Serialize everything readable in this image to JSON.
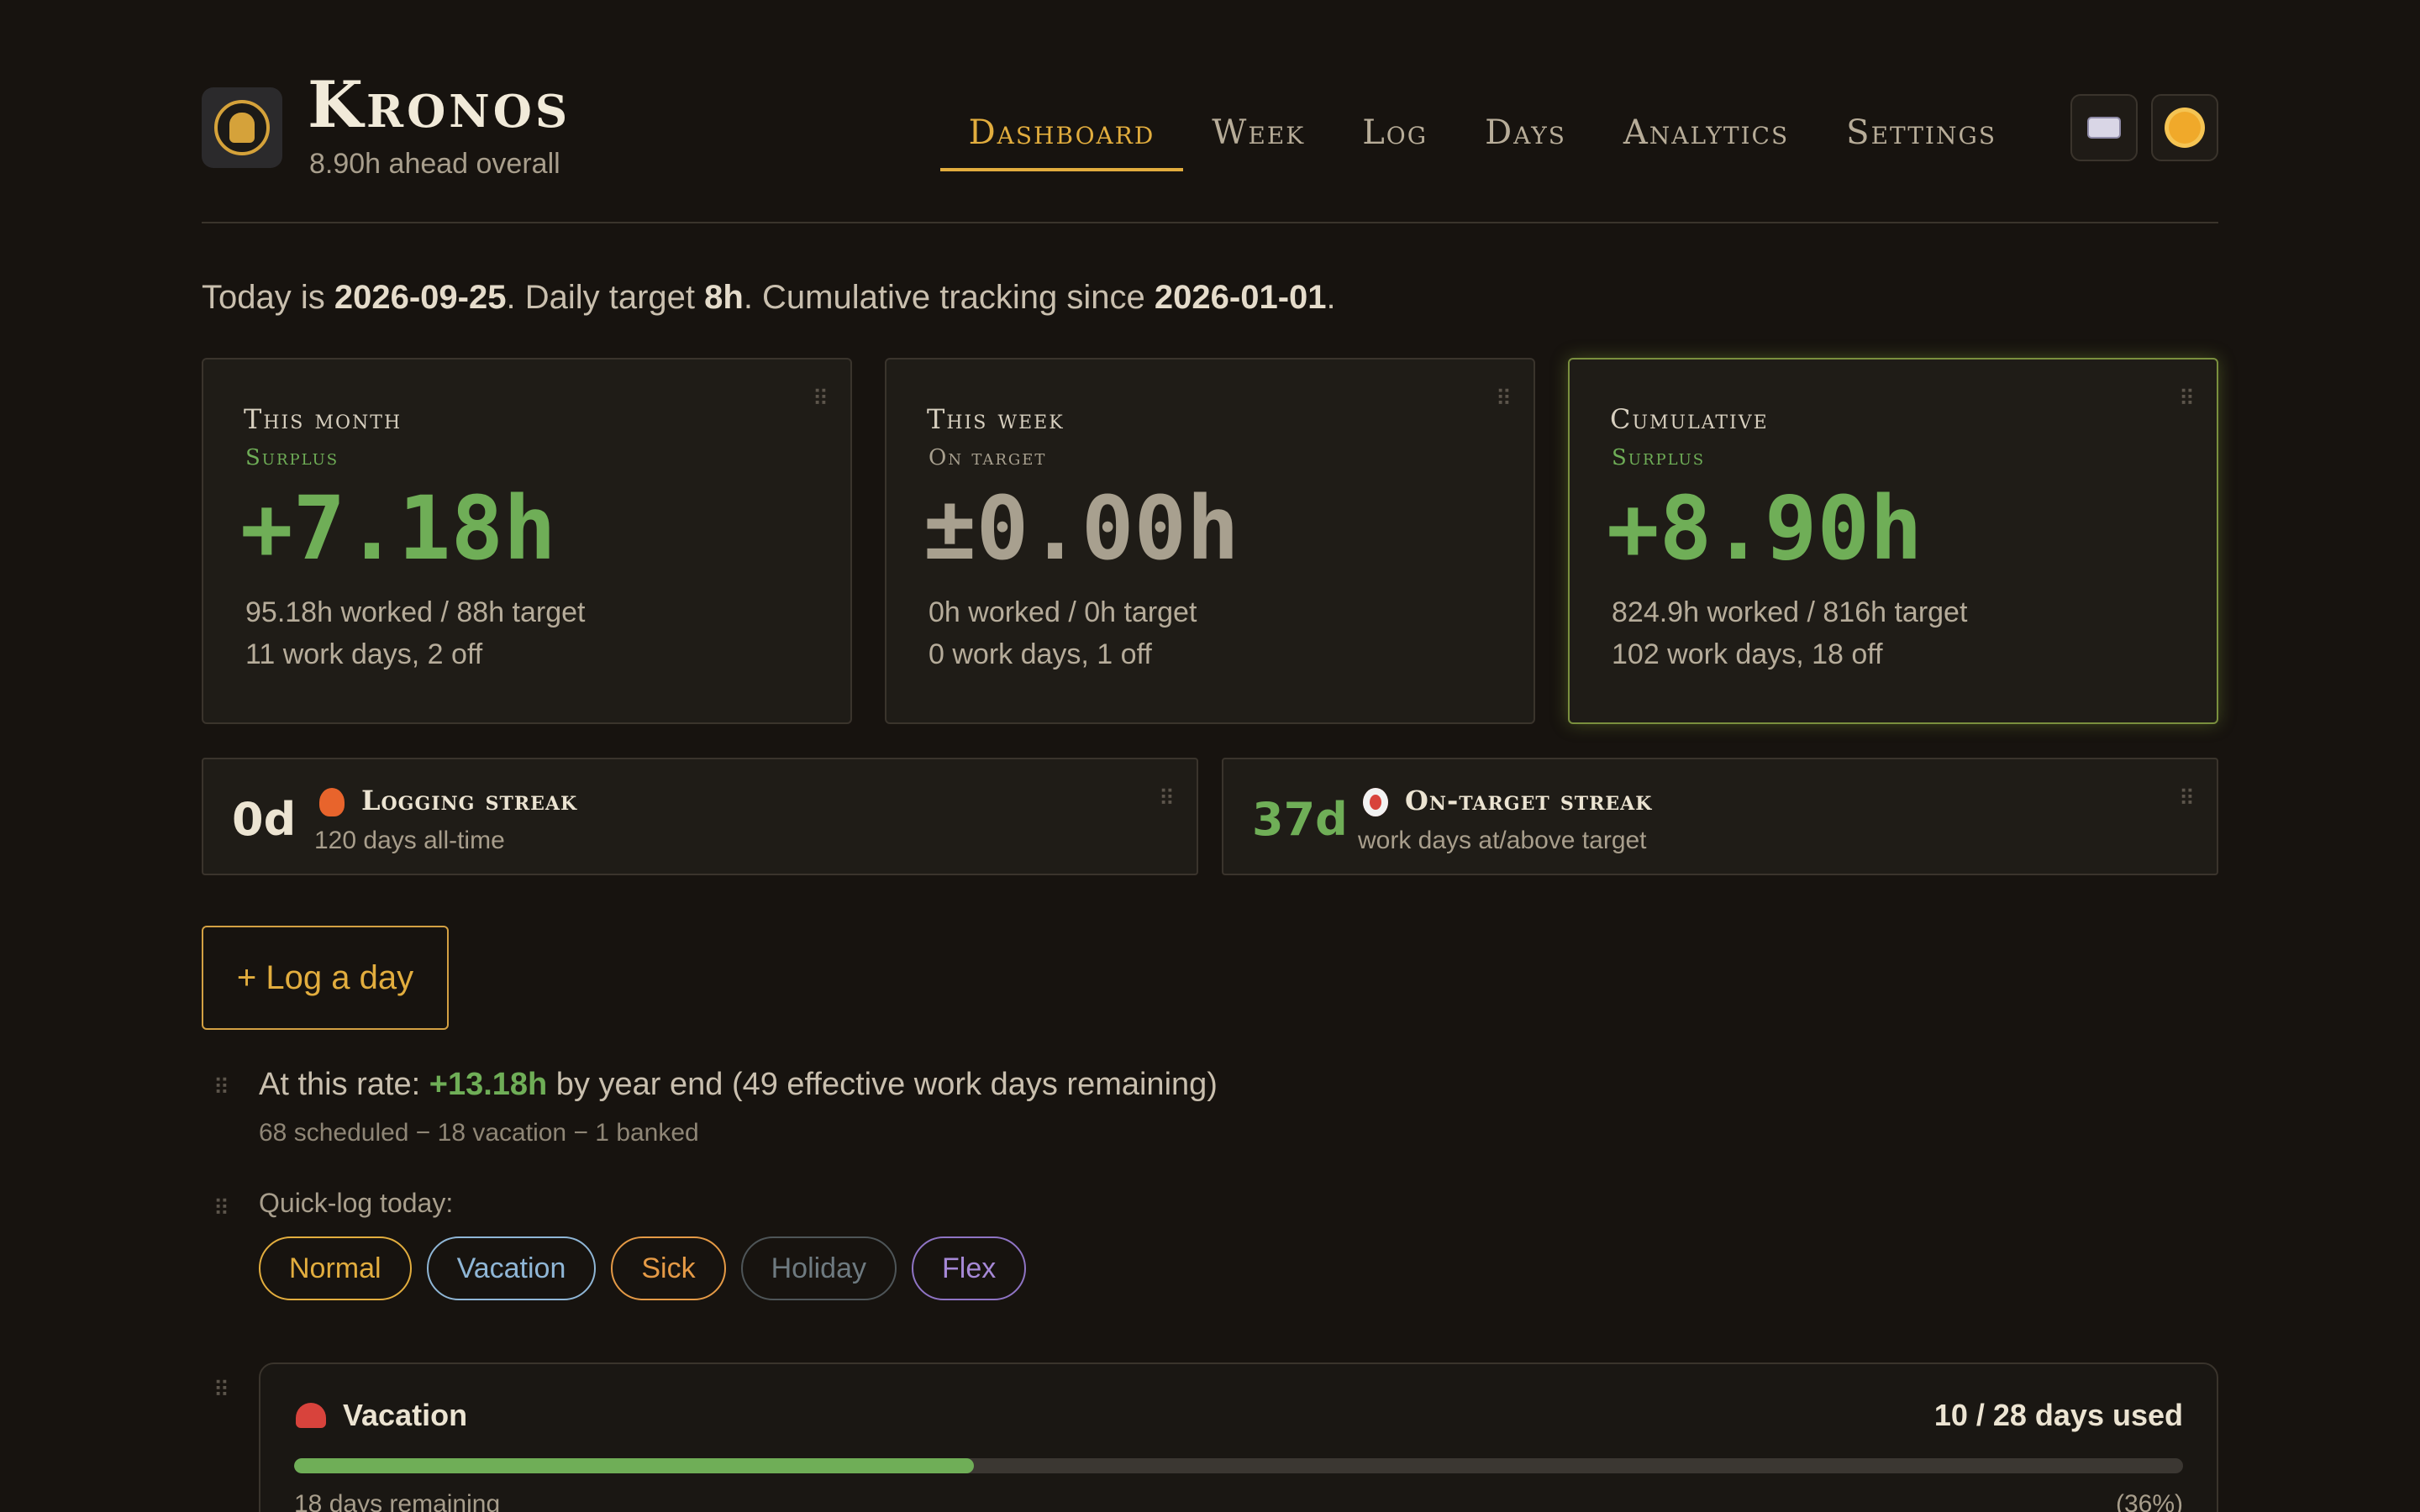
{
  "brand": {
    "title": "Kronos",
    "subtitle": "8.90h ahead overall",
    "logo_icon": "kronos-logo-icon"
  },
  "nav": {
    "items": [
      {
        "label": "Dashboard",
        "active": true
      },
      {
        "label": "Week",
        "active": false
      },
      {
        "label": "Log",
        "active": false
      },
      {
        "label": "Days",
        "active": false
      },
      {
        "label": "Analytics",
        "active": false
      },
      {
        "label": "Settings",
        "active": false
      }
    ],
    "shortcut_icon": "keyboard-icon",
    "theme_icon": "sun-icon"
  },
  "intro": {
    "prefix": "Today is ",
    "date": "2026-09-25",
    "mid1": ". Daily target ",
    "target": "8h",
    "mid2": ". Cumulative tracking since ",
    "since": "2026-01-01",
    "suffix": "."
  },
  "cards": [
    {
      "label": "This month",
      "status": "Surplus",
      "value": "+7.18h",
      "line1": "95.18h worked / 88h target",
      "line2": "11 work days, 2 off"
    },
    {
      "label": "This week",
      "status": "On target",
      "value": "±0.00h",
      "line1": "0h worked / 0h target",
      "line2": "0 work days, 1 off"
    },
    {
      "label": "Cumulative",
      "status": "Surplus",
      "value": "+8.90h",
      "line1": "824.9h worked / 816h target",
      "line2": "102 work days, 18 off"
    }
  ],
  "streaks": [
    {
      "count": "0d",
      "icon": "fire-icon",
      "title": "Logging streak",
      "sub": "120 days all-time"
    },
    {
      "count": "37d",
      "icon": "target-icon",
      "title": "On-target streak",
      "sub": "work days at/above target"
    }
  ],
  "log_button": "+ Log a day",
  "projection": {
    "prefix": "At this rate: ",
    "value": "+13.18h",
    "suffix": " by year end (49 effective work days remaining)",
    "detail": "68 scheduled − 18 vacation − 1 banked"
  },
  "quick_log": {
    "label": "Quick-log today:",
    "options": [
      "Normal",
      "Vacation",
      "Sick",
      "Holiday",
      "Flex"
    ]
  },
  "vacation": {
    "icon": "beach-umbrella-icon",
    "title": "Vacation",
    "used": "10 / 28 days used",
    "fraction": 0.36,
    "remaining": "18 days remaining",
    "percent": "(36%)"
  },
  "colors": {
    "accent": "#e2ad3e",
    "positive": "#6fae57",
    "background": "#17130f",
    "chip_normal": "#e2ad3e",
    "chip_vacation": "#8fb6d6",
    "chip_sick": "#e59a46",
    "chip_holiday": "#6e7a80",
    "chip_flex": "#a688d6"
  }
}
